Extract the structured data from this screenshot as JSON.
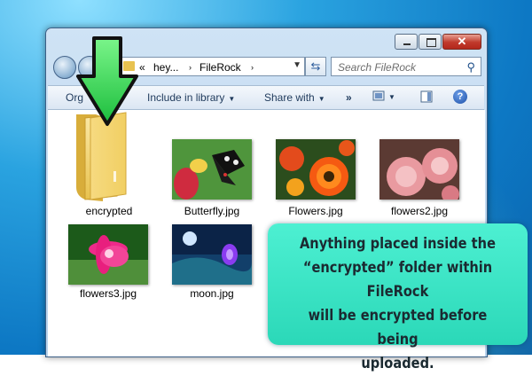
{
  "window": {
    "address_segments": [
      "«",
      "hey...",
      "›",
      "FileRock",
      "›"
    ],
    "search_placeholder": "Search FileRock",
    "caption_buttons": [
      "minimize",
      "maximize",
      "close"
    ]
  },
  "toolbar": {
    "organize_label": "Org",
    "include_label": "Include in library",
    "share_label": "Share with",
    "more_label": "»",
    "help_label": "?"
  },
  "files": [
    {
      "name": "encrypted",
      "type": "folder"
    },
    {
      "name": "Butterfly.jpg",
      "type": "image"
    },
    {
      "name": "Flowers.jpg",
      "type": "image"
    },
    {
      "name": "flowers2.jpg",
      "type": "image"
    },
    {
      "name": "flowers3.jpg",
      "type": "image"
    },
    {
      "name": "moon.jpg",
      "type": "image"
    }
  ],
  "callout": {
    "lines": [
      "Anything placed inside the",
      "“encrypted” folder within FileRock",
      "will be encrypted before being",
      "uploaded."
    ]
  },
  "colors": {
    "callout_bg": "#33e0c0",
    "arrow_fill": "#2fd84a",
    "folder_fill": "#f2d36a",
    "desktop_blue": "#1f8ad6"
  },
  "icons": [
    "back-arrow-icon",
    "forward-arrow-icon",
    "folder-icon",
    "refresh-icon",
    "search-icon",
    "view-icon",
    "preview-pane-icon",
    "help-icon",
    "down-arrow-icon"
  ]
}
